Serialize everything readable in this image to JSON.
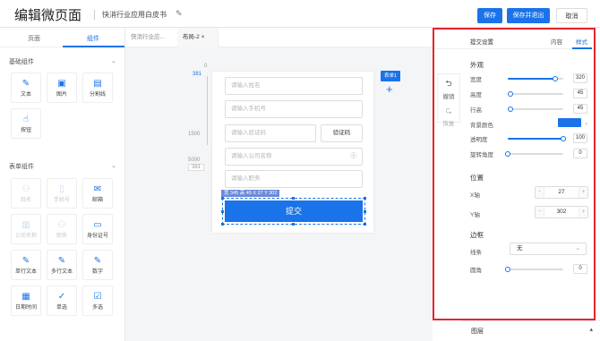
{
  "header": {
    "title": "编辑微页面",
    "subtitle": "快消行业应用白皮书",
    "save": "保存",
    "save_exit": "保存并退出",
    "cancel": "取消"
  },
  "left": {
    "tabs": [
      "页面",
      "组件"
    ],
    "group1": "基础组件",
    "basic": [
      {
        "label": "文本",
        "icon": "✎"
      },
      {
        "label": "图片",
        "icon": "▣"
      },
      {
        "label": "分割线",
        "icon": "▤"
      },
      {
        "label": "按钮",
        "icon": "☝"
      }
    ],
    "group2": "表单组件",
    "form": [
      {
        "label": "姓名",
        "icon": "⚇",
        "dim": true
      },
      {
        "label": "手机号",
        "icon": "▯",
        "dim": true
      },
      {
        "label": "邮箱",
        "icon": "✉",
        "dim": false
      },
      {
        "label": "公司名称",
        "icon": "▥",
        "dim": true
      },
      {
        "label": "职务",
        "icon": "⚇",
        "dim": true
      },
      {
        "label": "身份证号",
        "icon": "▭",
        "dim": false
      },
      {
        "label": "单行文本",
        "icon": "✎",
        "dim": false
      },
      {
        "label": "多行文本",
        "icon": "✎",
        "dim": false
      },
      {
        "label": "数字",
        "icon": "✎",
        "dim": false
      },
      {
        "label": "日期时间",
        "icon": "▦",
        "dim": false
      },
      {
        "label": "单选",
        "icon": "✓",
        "dim": false
      },
      {
        "label": "多选",
        "icon": "☑",
        "dim": false
      }
    ]
  },
  "canvas": {
    "tabs": [
      "快消行业应...",
      "布局-2 ×"
    ],
    "ruler": {
      "top": "0",
      "mark_381": "381",
      "v1500": "1500",
      "v5000": "5000",
      "v381": "381"
    },
    "fields": {
      "name": "请输入姓名",
      "phone": "请输入手机号",
      "code": "请输入验证码",
      "code_btn": "验证码",
      "company": "请输入公司名称",
      "position": "请输入职务"
    },
    "sel_label": "宽 345 高 45 X 27 Y 302",
    "submit": "提交",
    "form_badge": "表单1",
    "plus": "+",
    "undo": "撤销",
    "redo": "恢复"
  },
  "right": {
    "title": "提交设置",
    "tabs": [
      "内容",
      "样式"
    ],
    "appearance": "外观",
    "rows": [
      {
        "label": "宽度",
        "value": "320",
        "pct": 0.86
      },
      {
        "label": "高度",
        "value": "45",
        "pct": 0.05
      },
      {
        "label": "行高",
        "value": "45",
        "pct": 0.05
      }
    ],
    "bg_label": "背景颜色",
    "bg_color": "#1a73e8",
    "opacity_label": "透明度",
    "opacity": "100",
    "opacity_pct": 1.0,
    "rotate_label": "旋转角度",
    "rotate": "0",
    "rotate_pct": 0.0,
    "position": "位置",
    "x_label": "X轴",
    "x": "27",
    "y_label": "Y轴",
    "y": "302",
    "border": "边框",
    "line_label": "线条",
    "line_value": "无",
    "radius_label": "圆角",
    "radius": "0",
    "radius_pct": 0.0
  },
  "layers": {
    "label": "图层"
  }
}
